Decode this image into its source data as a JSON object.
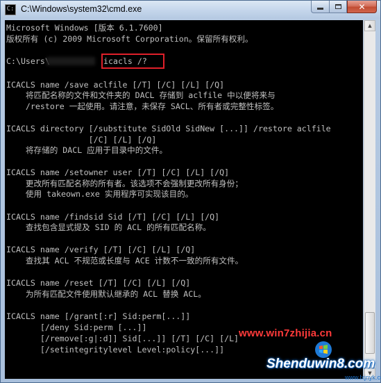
{
  "window": {
    "title": "C:\\Windows\\system32\\cmd.exe",
    "icon": "console-icon",
    "controls": {
      "minimize": "minimize-icon",
      "maximize": "maximize-icon",
      "close": "close-icon"
    }
  },
  "console": {
    "background": "#000000",
    "foreground": "#c0c0c0",
    "highlight_color": "#e0202a",
    "lines": [
      "Microsoft Windows [版本 6.1.7600]",
      "版权所有 (c) 2009 Microsoft Corporation。保留所有权利。",
      "",
      "C:\\Users\\",
      "icacls /?",
      "",
      "ICACLS name /save aclfile [/T] [/C] [/L] [/Q]",
      "    将匹配名称的文件和文件夹的 DACL 存储到 aclfile 中以便将来与",
      "    /restore 一起使用。请注意，未保存 SACL、所有者或完整性标签。",
      "",
      "ICACLS directory [/substitute SidOld SidNew [...]] /restore aclfile",
      "                 [/C] [/L] [/Q]",
      "    将存储的 DACL 应用于目录中的文件。",
      "",
      "ICACLS name /setowner user [/T] [/C] [/L] [/Q]",
      "    更改所有匹配名称的所有者。该选项不会强制更改所有身份；",
      "    使用 takeown.exe 实用程序可实现该目的。",
      "",
      "ICACLS name /findsid Sid [/T] [/C] [/L] [/Q]",
      "    查找包含显式提及 SID 的 ACL 的所有匹配名称。",
      "",
      "ICACLS name /verify [/T] [/C] [/L] [/Q]",
      "    查找其 ACL 不规范或长度与 ACE 计数不一致的所有文件。",
      "",
      "ICACLS name /reset [/T] [/C] [/L] [/Q]",
      "    为所有匹配文件使用默认继承的 ACL 替换 ACL。",
      "",
      "ICACLS name [/grant[:r] Sid:perm[...]]",
      "       [/deny Sid:perm [...]]",
      "       [/remove[:g|:d]] Sid[...]] [/T] [/C] [/L]",
      "       [/setintegritylevel Level:policy[...]]"
    ]
  },
  "watermark": {
    "site1": "www.win7zhijia.cn",
    "site2": "Shenduwin8.com",
    "site3": "www.lxjnyk.com",
    "logo": "windows-logo-icon"
  }
}
